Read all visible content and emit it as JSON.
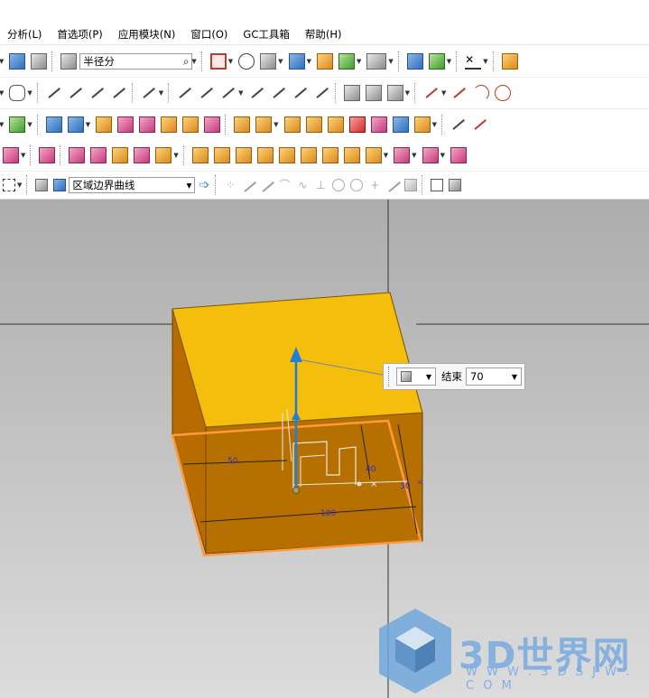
{
  "menu": {
    "items": [
      {
        "label": "分析(L)"
      },
      {
        "label": "首选项(P)"
      },
      {
        "label": "应用模块(N)"
      },
      {
        "label": "窗口(O)"
      },
      {
        "label": "GC工具箱"
      },
      {
        "label": "帮助(H)"
      }
    ]
  },
  "toolbar1": {
    "snap_field": "半径分"
  },
  "toolbar5": {
    "curve_rule": "区域边界曲线"
  },
  "viewport": {
    "background_top": "#adadad",
    "body_top_color": "#f5bd0c",
    "body_side_color": "#b96f00",
    "selection_color": "#ff9a3c",
    "vector_color": "#1f7fd8",
    "dim_labels": [
      "50",
      "100",
      "40",
      "30"
    ]
  },
  "extrude_popup": {
    "end_label": "结束",
    "end_value": "70"
  },
  "watermark": {
    "brand": "3D世界网",
    "url": "W W W . 3 D S J W . C O M"
  }
}
